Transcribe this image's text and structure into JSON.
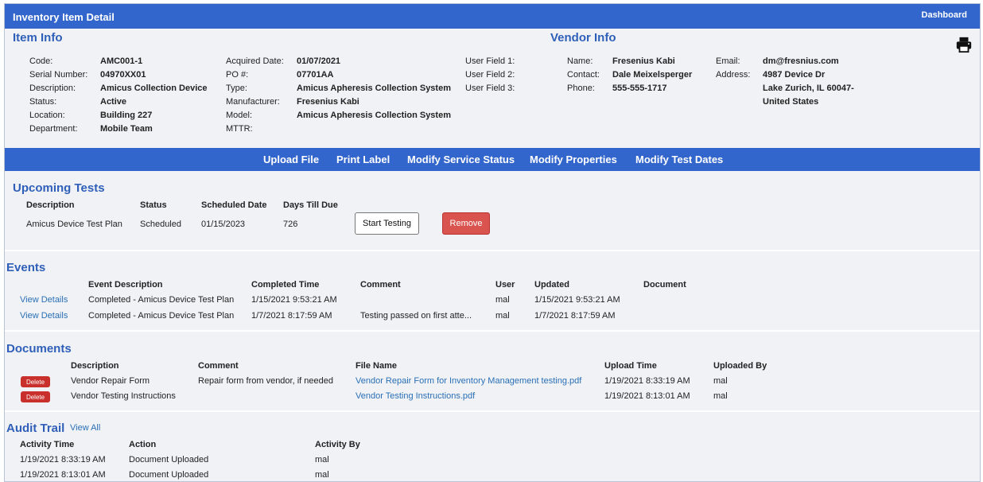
{
  "header": {
    "title": "Inventory Item Detail",
    "dashboard": "Dashboard"
  },
  "item_info": {
    "heading": "Item Info",
    "col1": [
      {
        "k": "Code:",
        "v": "AMC001-1"
      },
      {
        "k": "Serial Number:",
        "v": "04970XX01"
      },
      {
        "k": "Description:",
        "v": "Amicus Collection Device"
      },
      {
        "k": "Status:",
        "v": "Active"
      },
      {
        "k": "Location:",
        "v": "Building 227"
      },
      {
        "k": "Department:",
        "v": "Mobile Team"
      }
    ],
    "col2": [
      {
        "k": "Acquired Date:",
        "v": "01/07/2021"
      },
      {
        "k": "PO #:",
        "v": "07701AA"
      },
      {
        "k": "Type:",
        "v": "Amicus Apheresis Collection System"
      },
      {
        "k": "Manufacturer:",
        "v": "Fresenius Kabi"
      },
      {
        "k": "Model:",
        "v": "Amicus Apheresis Collection System"
      },
      {
        "k": "MTTR:",
        "v": ""
      }
    ],
    "user_fields": [
      "User Field 1:",
      "User Field 2:",
      "User Field 3:"
    ]
  },
  "vendor_info": {
    "heading": "Vendor Info",
    "col1": [
      {
        "k": "Name:",
        "v": "Fresenius Kabi"
      },
      {
        "k": "Contact:",
        "v": "Dale Meixelsperger"
      },
      {
        "k": "Phone:",
        "v": "555-555-1717"
      }
    ],
    "email_label": "Email:",
    "email": "dm@fresnius.com",
    "address_label": "Address:",
    "address_lines": [
      "4987 Device Dr",
      "Lake Zurich, IL 60047-",
      "United States"
    ]
  },
  "actions": [
    "Upload File",
    "Print Label",
    "Modify Service Status",
    "Modify Properties",
    "Modify Test Dates"
  ],
  "upcoming_tests": {
    "heading": "Upcoming Tests",
    "headers": [
      "Description",
      "Status",
      "Scheduled Date",
      "Days Till Due"
    ],
    "row": [
      "Amicus Device Test Plan",
      "Scheduled",
      "01/15/2023",
      "726"
    ],
    "start_label": "Start Testing",
    "remove_label": "Remove"
  },
  "events": {
    "heading": "Events",
    "headers": [
      "Event Description",
      "Completed Time",
      "Comment",
      "User",
      "Updated",
      "Document"
    ],
    "link_label": "View Details",
    "rows": [
      [
        "Completed - Amicus Device Test Plan",
        "1/15/2021 9:53:21 AM",
        "",
        "mal",
        "1/15/2021 9:53:21 AM",
        ""
      ],
      [
        "Completed - Amicus Device Test Plan",
        "1/7/2021 8:17:59 AM",
        "Testing passed on first atte...",
        "mal",
        "1/7/2021 8:17:59 AM",
        ""
      ]
    ]
  },
  "documents": {
    "heading": "Documents",
    "headers": [
      "Description",
      "Comment",
      "File Name",
      "Upload Time",
      "Uploaded By"
    ],
    "delete_label": "Delete",
    "rows": [
      [
        "Vendor Repair Form",
        "Repair form from vendor, if needed",
        "Vendor Repair Form for Inventory Management testing.pdf",
        "1/19/2021 8:33:19 AM",
        "mal"
      ],
      [
        "Vendor Testing Instructions",
        "",
        "Vendor Testing Instructions.pdf",
        "1/19/2021 8:13:01 AM",
        "mal"
      ]
    ]
  },
  "audit": {
    "heading": "Audit Trail",
    "view_all": "View All",
    "headers": [
      "Activity Time",
      "Action",
      "Activity By"
    ],
    "rows": [
      [
        "1/19/2021 8:33:19 AM",
        "Document Uploaded",
        "mal"
      ],
      [
        "1/19/2021 8:13:01 AM",
        "Document Uploaded",
        "mal"
      ]
    ]
  },
  "colors": {
    "header_blue": "#3366cc",
    "section_heading": "#2f5fb8",
    "link": "#2a6fb5",
    "danger": "#d9534f"
  }
}
